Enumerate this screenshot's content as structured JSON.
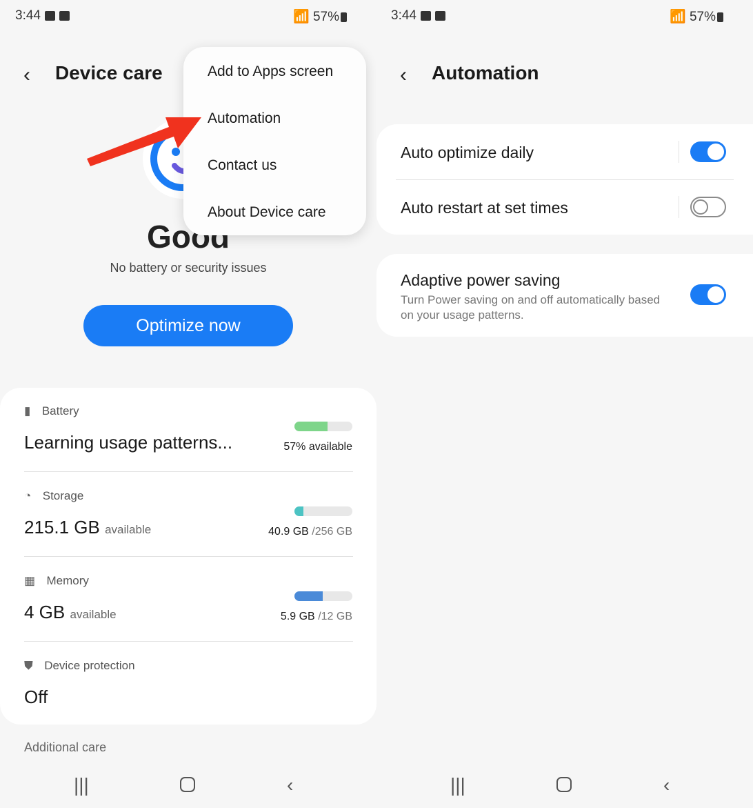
{
  "status_bar": {
    "time": "3:44",
    "battery": "57%"
  },
  "left": {
    "header": {
      "title": "Device care"
    },
    "status": {
      "headline": "Good",
      "subtitle": "No battery or security issues"
    },
    "optimize_button": "Optimize now",
    "menu": {
      "items": [
        "Add to Apps screen",
        "Automation",
        "Contact us",
        "About Device care"
      ]
    },
    "items": [
      {
        "label": "Battery",
        "value": "Learning usage patterns...",
        "unit": "",
        "detail_bold": "57% available",
        "detail": "",
        "fill": 0.57,
        "color": "#7ed58a",
        "icon": "battery-icon"
      },
      {
        "label": "Storage",
        "value": "215.1 GB",
        "unit": "available",
        "detail_bold": "40.9 GB",
        "detail": "/256 GB",
        "fill": 0.16,
        "color": "#4cc3c3",
        "icon": "storage-pie-icon"
      },
      {
        "label": "Memory",
        "value": "4 GB",
        "unit": "available",
        "detail_bold": "5.9 GB",
        "detail": "/12 GB",
        "fill": 0.49,
        "color": "#4a8ad8",
        "icon": "memory-chip-icon"
      },
      {
        "label": "Device protection",
        "value": "Off",
        "icon": "shield-icon"
      }
    ],
    "additional_care": "Additional care"
  },
  "right": {
    "header": {
      "title": "Automation"
    },
    "settings": [
      {
        "label": "Auto optimize daily",
        "on": true
      },
      {
        "label": "Auto restart at set times",
        "on": false
      },
      {
        "label": "Adaptive power saving",
        "description": "Turn Power saving on and off automatically based on your usage patterns.",
        "on": true
      }
    ]
  },
  "colors": {
    "accent": "#1a7cf5",
    "annotation_arrow": "#f0321e"
  }
}
